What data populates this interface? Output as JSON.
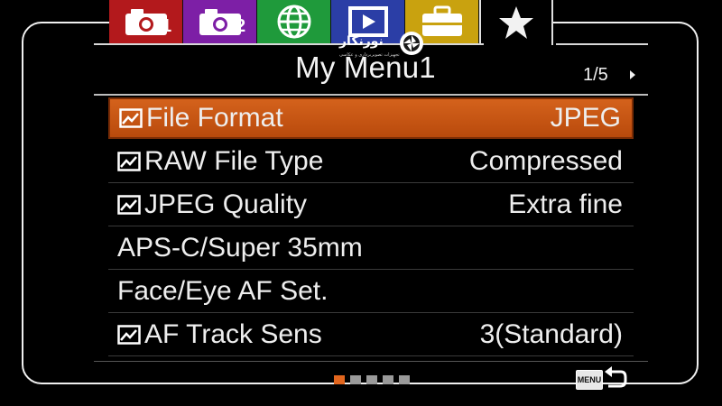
{
  "tabs": [
    {
      "icon": "camera-icon",
      "sub": "1",
      "color": "#b3191c"
    },
    {
      "icon": "camera-icon",
      "sub": "2",
      "color": "#7d1fa6"
    },
    {
      "icon": "globe-icon",
      "sub": "",
      "color": "#1f9a3b"
    },
    {
      "icon": "playback-icon",
      "sub": "",
      "color": "#2b3ea6"
    },
    {
      "icon": "toolbox-icon",
      "sub": "",
      "color": "#c9a20f"
    },
    {
      "icon": "star-icon",
      "sub": "",
      "color": "#000000",
      "active": true
    }
  ],
  "header": {
    "title": "My Menu1",
    "page": "1/5"
  },
  "watermark": {
    "brand": "نورنگار",
    "tagline": "تجهیزات تصویربرداری و عکاسی"
  },
  "menu": {
    "items": [
      {
        "label": "File Format",
        "value": "JPEG",
        "icon": "still-image-icon",
        "selected": true
      },
      {
        "label": "RAW File Type",
        "value": "Compressed",
        "icon": "still-image-icon"
      },
      {
        "label": "JPEG Quality",
        "value": "Extra fine",
        "icon": "still-image-icon"
      },
      {
        "label": "APS-C/Super 35mm",
        "value": "",
        "icon": ""
      },
      {
        "label": "Face/Eye AF Set.",
        "value": "",
        "icon": ""
      },
      {
        "label": "AF Track Sens",
        "value": "3(Standard)",
        "icon": "still-image-icon"
      }
    ]
  },
  "footer": {
    "pages": 5,
    "current_page": 1,
    "menu_label": "MENU"
  },
  "colors": {
    "accent": "#d4621c",
    "inactive_dot": "#9a9a9a"
  }
}
